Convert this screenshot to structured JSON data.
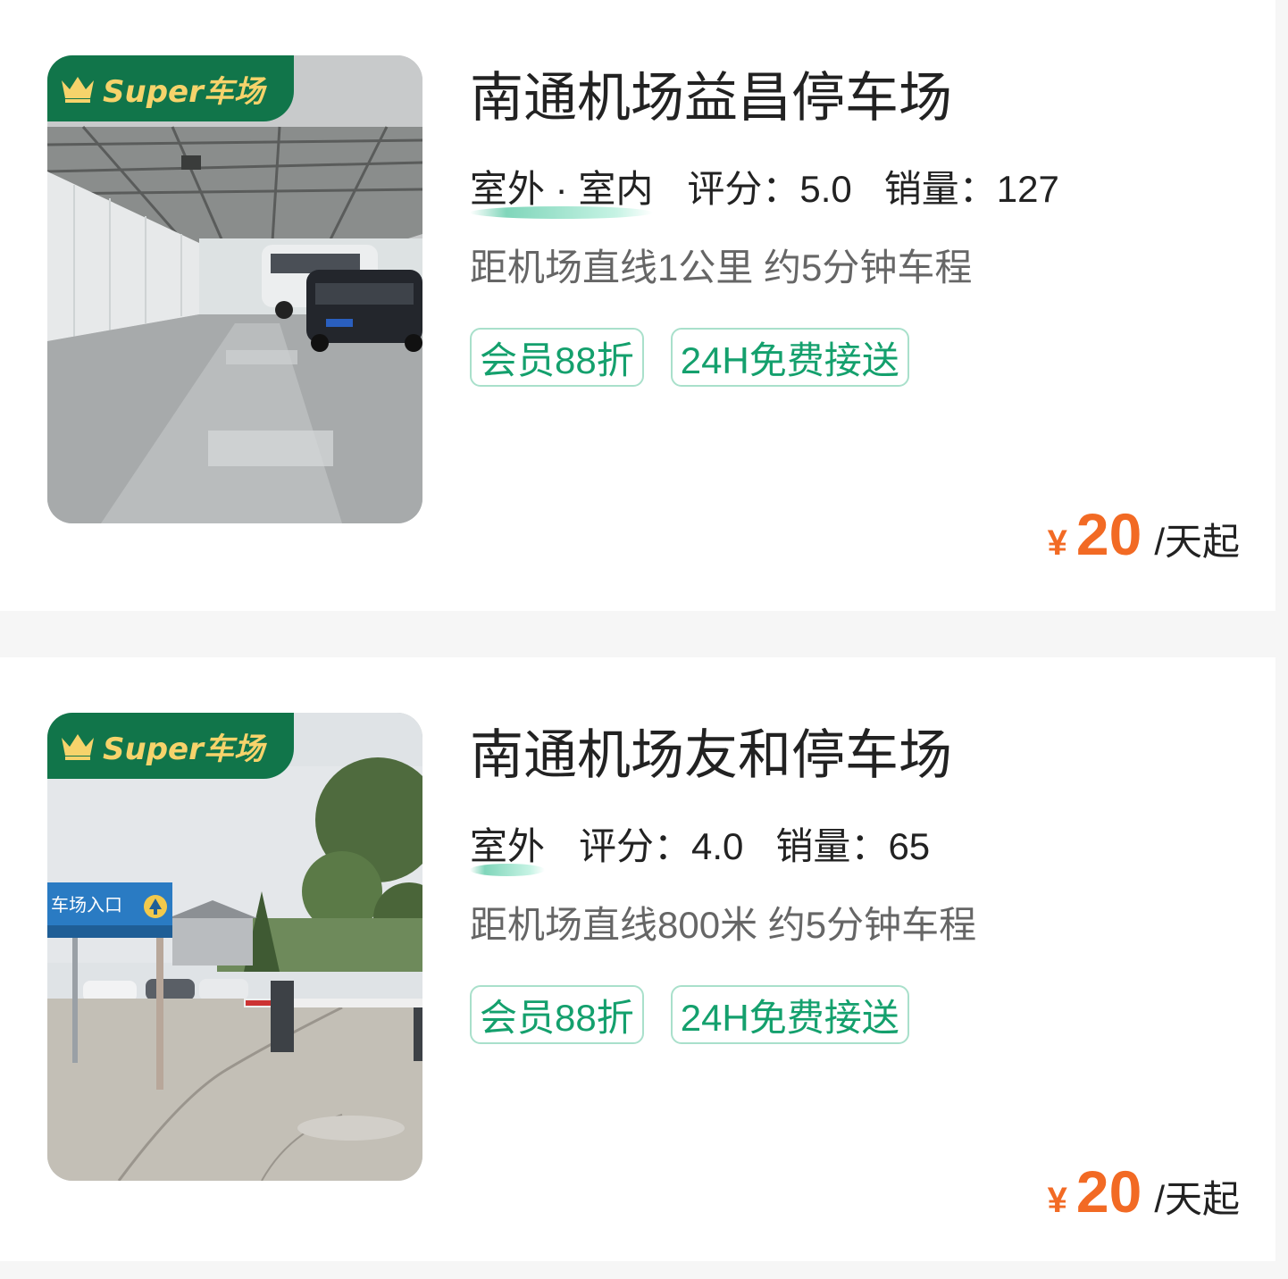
{
  "badge_text": "Super车场",
  "colors": {
    "brand_green": "#11754a",
    "badge_gold": "#f6d36b",
    "tag_green": "#14a06d",
    "price_orange": "#f26a24"
  },
  "parkings": [
    {
      "name": "南通机场益昌停车场",
      "type": "室外 · 室内",
      "rating_label": "评分：",
      "rating": "5.0",
      "sales_label": "销量：",
      "sales": "127",
      "distance": "距机场直线1公里 约5分钟车程",
      "tags": [
        "会员88折",
        "24H免费接送"
      ],
      "currency": "¥",
      "price": "20",
      "price_unit": "/天起",
      "photo": "indoor-garage-photo"
    },
    {
      "name": "南通机场友和停车场",
      "type": "室外",
      "rating_label": "评分：",
      "rating": "4.0",
      "sales_label": "销量：",
      "sales": "65",
      "distance": "距机场直线800米 约5分钟车程",
      "tags": [
        "会员88折",
        "24H免费接送"
      ],
      "currency": "¥",
      "price": "20",
      "price_unit": "/天起",
      "photo": "outdoor-lot-photo",
      "photo_sign_text": "车场入口"
    }
  ]
}
